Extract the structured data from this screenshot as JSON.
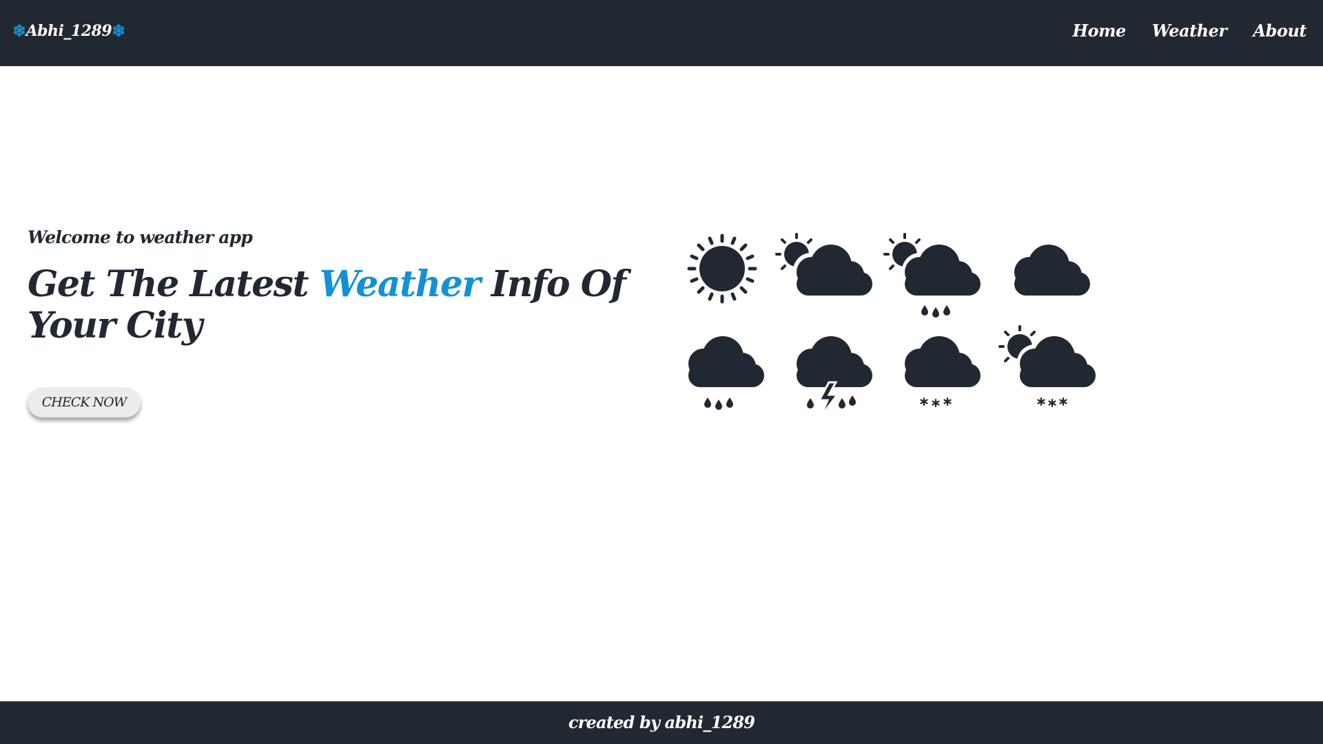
{
  "navbar": {
    "brand_name": "Abhi_1289",
    "brand_icon": "snowflake-icon",
    "links": [
      "Home",
      "Weather",
      "About"
    ]
  },
  "hero": {
    "welcome": "Welcome to weather app",
    "headline_before": "Get The Latest ",
    "headline_accent": "Weather",
    "headline_after": " Info Of Your City",
    "cta_label": "CHECK NOW"
  },
  "weather_icons": [
    "sun-icon",
    "partly-cloudy-icon",
    "partly-cloudy-rain-icon",
    "cloud-icon",
    "rain-icon",
    "thunderstorm-icon",
    "snow-icon",
    "partly-cloudy-snow-icon"
  ],
  "footer": {
    "text": "created by abhi_1289"
  },
  "colors": {
    "dark": "#222831",
    "accent": "#1391d4",
    "button_bg": "#ececec"
  }
}
